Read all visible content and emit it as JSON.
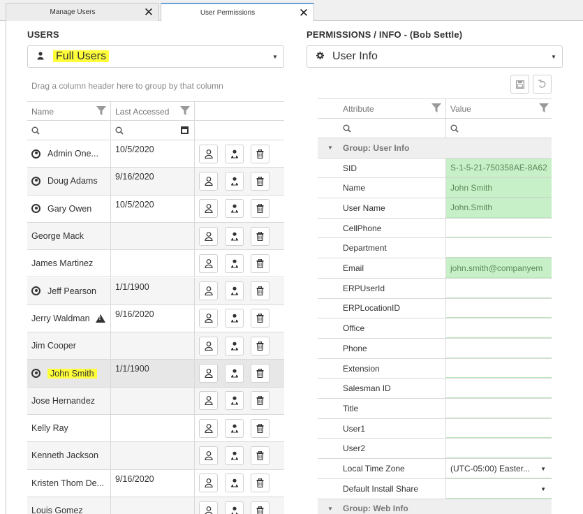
{
  "tabs": [
    {
      "label": "Manage Users",
      "close": "✕"
    },
    {
      "label": "User Permissions",
      "close": "✕"
    }
  ],
  "users_panel": {
    "title": "USERS",
    "selector": {
      "value": "Full Users",
      "icon": "person-icon"
    },
    "group_hint": "Drag a column header here to group by that column",
    "columns": [
      "Name",
      "Last Accessed"
    ],
    "rows": [
      {
        "name": "Admin One...",
        "date": "10/5/2020",
        "user_icon": true,
        "warning": false,
        "highlight": false
      },
      {
        "name": "Doug Adams",
        "date": "9/16/2020",
        "user_icon": true,
        "warning": false,
        "highlight": false
      },
      {
        "name": "Gary Owen",
        "date": "10/5/2020",
        "user_icon": true,
        "warning": false,
        "highlight": false
      },
      {
        "name": "George Mack",
        "date": "",
        "user_icon": false,
        "warning": false,
        "highlight": false
      },
      {
        "name": "James Martinez",
        "date": "",
        "user_icon": false,
        "warning": false,
        "highlight": false
      },
      {
        "name": "Jeff Pearson",
        "date": "1/1/1900",
        "user_icon": true,
        "warning": false,
        "highlight": false
      },
      {
        "name": "Jerry Waldman",
        "date": "9/16/2020",
        "user_icon": false,
        "warning": true,
        "highlight": false
      },
      {
        "name": "Jim Cooper",
        "date": "",
        "user_icon": false,
        "warning": false,
        "highlight": false
      },
      {
        "name": "John Smith",
        "date": "1/1/1900",
        "user_icon": true,
        "warning": false,
        "highlight": true
      },
      {
        "name": "Jose Hernandez",
        "date": "",
        "user_icon": false,
        "warning": false,
        "highlight": false
      },
      {
        "name": "Kelly Ray",
        "date": "",
        "user_icon": false,
        "warning": false,
        "highlight": false
      },
      {
        "name": "Kenneth Jackson",
        "date": "",
        "user_icon": false,
        "warning": false,
        "highlight": false
      },
      {
        "name": "Kristen Thom De...",
        "date": "9/16/2020",
        "user_icon": false,
        "warning": false,
        "highlight": false
      },
      {
        "name": "Louis Gomez",
        "date": "",
        "user_icon": false,
        "warning": false,
        "highlight": false
      }
    ],
    "selected_row": "John Smith"
  },
  "permissions_panel": {
    "title": "PERMISSIONS / INFO - (Bob Settle)",
    "selector": {
      "value": "User Info",
      "icon": "gear-icon"
    },
    "columns": [
      "Attribute",
      "Value"
    ],
    "group_1": "Group: User Info",
    "rows": [
      {
        "attr": "SID",
        "value": "S-1-5-21-750358AE-8A62",
        "green": true,
        "dropdown": false
      },
      {
        "attr": "Name",
        "value": "John Smith",
        "green": true,
        "dropdown": false
      },
      {
        "attr": "User Name",
        "value": "John.Smith",
        "green": true,
        "dropdown": false
      },
      {
        "attr": "CellPhone",
        "value": "",
        "green": false,
        "dropdown": false
      },
      {
        "attr": "Department",
        "value": "",
        "green": false,
        "dropdown": false
      },
      {
        "attr": "Email",
        "value": "john.smith@companyem",
        "green": true,
        "dropdown": false
      },
      {
        "attr": "ERPUserId",
        "value": "",
        "green": false,
        "dropdown": false
      },
      {
        "attr": "ERPLocationID",
        "value": "",
        "green": false,
        "dropdown": false
      },
      {
        "attr": "Office",
        "value": "",
        "green": false,
        "dropdown": false
      },
      {
        "attr": "Phone",
        "value": "",
        "green": false,
        "dropdown": false
      },
      {
        "attr": "Extension",
        "value": "",
        "green": false,
        "dropdown": false
      },
      {
        "attr": "Salesman ID",
        "value": "",
        "green": false,
        "dropdown": false
      },
      {
        "attr": "Title",
        "value": "",
        "green": false,
        "dropdown": false
      },
      {
        "attr": "User1",
        "value": "",
        "green": false,
        "dropdown": false
      },
      {
        "attr": "User2",
        "value": "",
        "green": false,
        "dropdown": false
      },
      {
        "attr": "Local Time Zone",
        "value": "(UTC-05:00) Easter...",
        "green": false,
        "dropdown": true
      },
      {
        "attr": "Default Install Share",
        "value": "",
        "green": false,
        "dropdown": true
      }
    ],
    "group_2": "Group: Web Info"
  },
  "colors": {
    "highlight": "#ffff3a",
    "green_cell": "#c8f0c8",
    "tab_accent": "#6aa0d8"
  }
}
